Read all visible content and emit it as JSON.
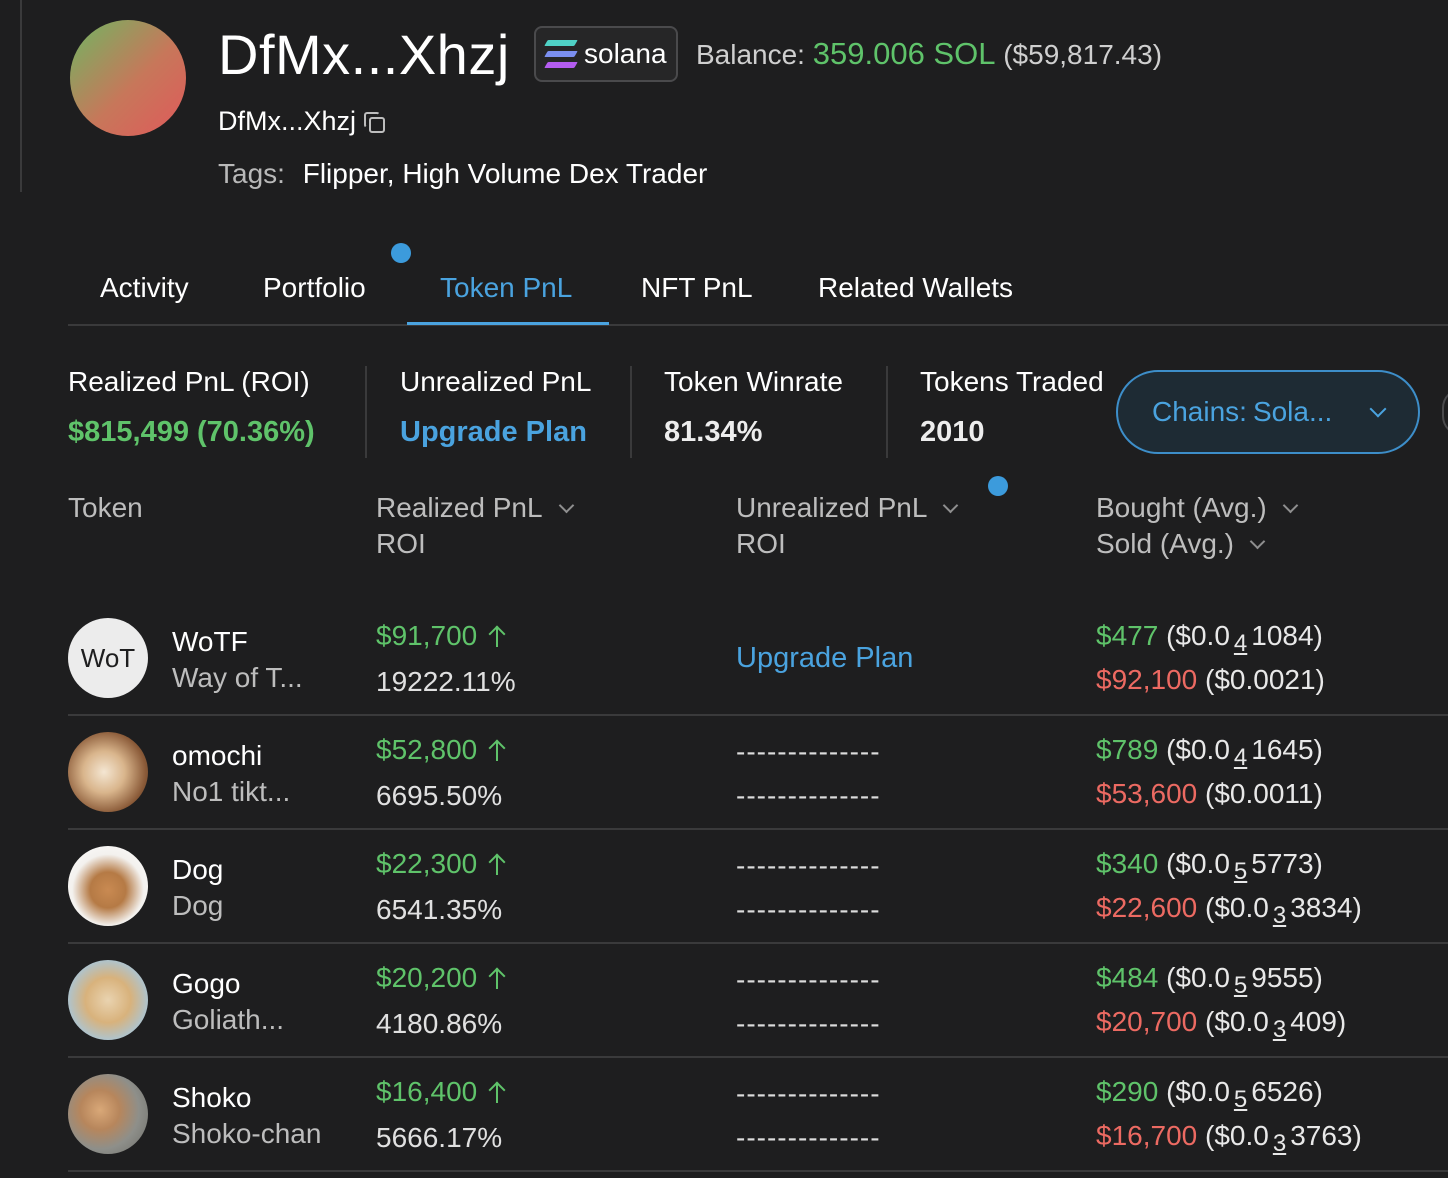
{
  "wallet": {
    "title": "DfMx...Xhzj",
    "chain": "solana",
    "balance_label": "Balance:",
    "balance_sol": "359.006 SOL",
    "balance_usd": "($59,817.43)",
    "address": "DfMx...Xhzj",
    "tags_label": "Tags:",
    "tags": "Flipper, High Volume Dex Trader",
    "icons": {
      "copy": "copy-icon",
      "chain": "solana-icon"
    }
  },
  "tabs": [
    {
      "label": "Activity"
    },
    {
      "label": "Portfolio"
    },
    {
      "label": "Token PnL",
      "active": true
    },
    {
      "label": "NFT PnL"
    },
    {
      "label": "Related Wallets"
    }
  ],
  "stats": {
    "realized": {
      "label": "Realized PnL (ROI)",
      "value": "$815,499 (70.36%)"
    },
    "unrealized": {
      "label": "Unrealized PnL",
      "value": "Upgrade Plan"
    },
    "winrate": {
      "label": "Token Winrate",
      "value": "81.34%"
    },
    "traded": {
      "label": "Tokens Traded",
      "value": "2010"
    }
  },
  "chains_filter": {
    "label": "Chains:",
    "value": "Sola..."
  },
  "table": {
    "headers": {
      "token": "Token",
      "realized": "Realized PnL",
      "realized_sub": "ROI",
      "unrealized": "Unrealized PnL",
      "unrealized_sub": "ROI",
      "bought": "Bought (Avg.)",
      "sold": "Sold (Avg.)"
    },
    "rows": [
      {
        "symbol": "WoTF",
        "name": "Way of T...",
        "avatar_text": "WoT",
        "realized": "$91,700",
        "roi": "19222.11%",
        "unrealized": "Upgrade Plan",
        "unrealized_roi": "",
        "bought": "$477",
        "bought_pre": "($0.0",
        "bought_sub": "4",
        "bought_post": "1084)",
        "sold": "$92,100",
        "sold_pre": "($0.0021)",
        "sold_sub": "",
        "sold_post": ""
      },
      {
        "symbol": "omochi",
        "name": "No1 tikt...",
        "avatar_text": "",
        "realized": "$52,800",
        "roi": "6695.50%",
        "unrealized": "--------------",
        "unrealized_roi": "--------------",
        "bought": "$789",
        "bought_pre": "($0.0",
        "bought_sub": "4",
        "bought_post": "1645)",
        "sold": "$53,600",
        "sold_pre": "($0.0011)",
        "sold_sub": "",
        "sold_post": ""
      },
      {
        "symbol": "Dog",
        "name": "Dog",
        "avatar_text": "",
        "realized": "$22,300",
        "roi": "6541.35%",
        "unrealized": "--------------",
        "unrealized_roi": "--------------",
        "bought": "$340",
        "bought_pre": "($0.0",
        "bought_sub": "5",
        "bought_post": "5773)",
        "sold": "$22,600",
        "sold_pre": "($0.0",
        "sold_sub": "3",
        "sold_post": "3834)"
      },
      {
        "symbol": "Gogo",
        "name": "Goliath...",
        "avatar_text": "",
        "realized": "$20,200",
        "roi": "4180.86%",
        "unrealized": "--------------",
        "unrealized_roi": "--------------",
        "bought": "$484",
        "bought_pre": "($0.0",
        "bought_sub": "5",
        "bought_post": "9555)",
        "sold": "$20,700",
        "sold_pre": "($0.0",
        "sold_sub": "3",
        "sold_post": "409)"
      },
      {
        "symbol": "Shoko",
        "name": "Shoko-chan",
        "avatar_text": "",
        "realized": "$16,400",
        "roi": "5666.17%",
        "unrealized": "--------------",
        "unrealized_roi": "--------------",
        "bought": "$290",
        "bought_pre": "($0.0",
        "bought_sub": "5",
        "bought_post": "6526)",
        "sold": "$16,700",
        "sold_pre": "($0.0",
        "sold_sub": "3",
        "sold_post": "3763)"
      }
    ]
  },
  "colors": {
    "accent": "#4aa3df",
    "positive": "#5fc36a",
    "negative": "#ec6a62",
    "background": "#1e1e1f"
  }
}
